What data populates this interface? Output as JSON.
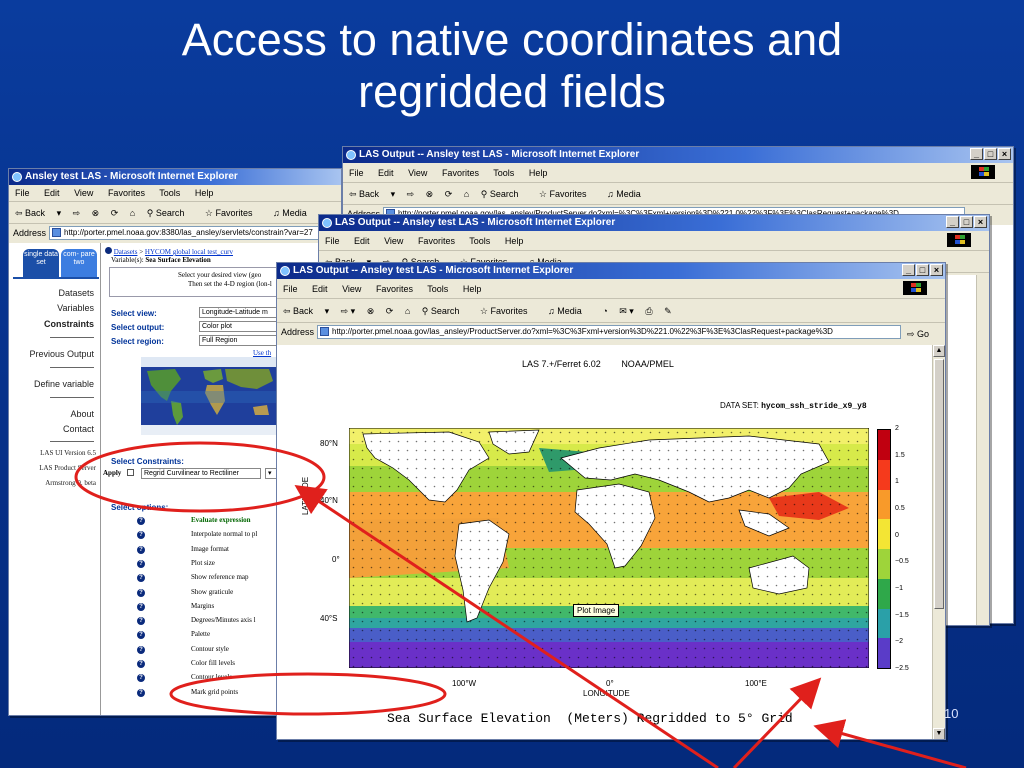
{
  "slide": {
    "title_line1": "Access to native coordinates and",
    "title_line2": "regridded fields",
    "page_number": "10"
  },
  "window_left": {
    "title": "Ansley test LAS - Microsoft Internet Explorer",
    "menu": [
      "File",
      "Edit",
      "View",
      "Favorites",
      "Tools",
      "Help"
    ],
    "toolbar": [
      "Back",
      "Search",
      "Favorites",
      "Media"
    ],
    "address_label": "Address",
    "address_url": "http://porter.pmel.noaa.gov:8380/las_ansley/servlets/constrain?var=27",
    "tabs": [
      {
        "label": "single data set"
      },
      {
        "label": "com- pare two"
      }
    ],
    "nav": [
      "Datasets",
      "Variables",
      "Constraints",
      "Previous Output",
      "Define variable",
      "About",
      "Contact"
    ],
    "nav_footer": [
      "LAS UI Version 6.5",
      "LAS Product Server",
      "Armstrong 0. beta"
    ],
    "breadcrumb_datasets": "Datasets",
    "breadcrumb_sep": " > ",
    "breadcrumb_dataset": "HYCOM global local test_curv",
    "variable_label": "Variable(s):",
    "variable_value": "Sea Surface Elevation",
    "instructions_1": "Select your desired view (geo",
    "instructions_2": "Then set the 4-D region (lon-l",
    "select_view_label": "Select view:",
    "select_view_value": "Longitude-Latitude m",
    "select_output_label": "Select output:",
    "select_output_value": "Color plot",
    "select_region_label": "Select region:",
    "select_region_value": "Full Region",
    "use_link": "Use th",
    "constraints_label": "Select Constraints:",
    "apply_label": "Apply",
    "regrid_value": "Regrid Curvilinear to Rectiliner",
    "options_label": "Select options:",
    "options": [
      "Evaluate expression",
      "Interpolate normal to pl",
      "Image format",
      "Plot size",
      "Show reference map",
      "Show graticule",
      "Margins",
      "Degrees/Minutes axis l",
      "Palette",
      "Contour style",
      "Color fill levels",
      "Contour levels",
      "Mark grid points"
    ]
  },
  "window_back2": {
    "title": "LAS Output -- Ansley test LAS - Microsoft Internet Explorer",
    "menu": [
      "File",
      "Edit",
      "View",
      "Favorites",
      "Tools",
      "Help"
    ],
    "toolbar": [
      "Back",
      "Search",
      "Favorites",
      "Media"
    ],
    "address_label": "Address",
    "address_url": "http://porter.pmel.noaa.gov/las_ansley/ProductServer.do?xml=%3C%3Fxml+version%3D%221.0%22%3F%3E%3ClasRequest+package%3D"
  },
  "window_back1": {
    "title": "LAS Output -- Ansley test LAS - Microsoft Internet Explorer",
    "menu": [
      "File",
      "Edit",
      "View",
      "Favorites",
      "Tools",
      "Help"
    ],
    "toolbar": [
      "Back",
      "Search",
      "Favorites",
      "Media"
    ]
  },
  "window_main": {
    "title": "LAS Output -- Ansley test LAS - Microsoft Internet Explorer",
    "menu": [
      "File",
      "Edit",
      "View",
      "Favorites",
      "Tools",
      "Help"
    ],
    "toolbar": [
      "Back",
      "Search",
      "Favorites",
      "Media"
    ],
    "address_label": "Address",
    "address_url": "http://porter.pmel.noaa.gov/las_ansley/ProductServer.do?xml=%3C%3Fxml+version%3D%221.0%22%3F%3E%3ClasRequest+package%3D",
    "go_label": "Go",
    "plot": {
      "header_left": "LAS 7.+/Ferret 6.02",
      "header_right": "NOAA/PMEL",
      "dataset_label": "DATA SET:",
      "dataset_name": "hycom_ssh_stride_x9_y8",
      "lat_ticks": [
        "80°N",
        "40°N",
        "0°",
        "40°S"
      ],
      "lon_ticks": [
        "100°W",
        "0°",
        "100°E"
      ],
      "ylabel": "LATITUDE",
      "xlabel": "LONGITUDE",
      "tooltip": "Plot Image",
      "caption": "Sea Surface Elevation  (Meters) Regridded to 5° Grid",
      "colorbar_labels": [
        "2",
        "1.5",
        "1",
        "0.5",
        "0",
        "−0.5",
        "−1",
        "−1.5",
        "−2",
        "−2.5"
      ]
    }
  },
  "colors": {
    "slide_background": "#063089",
    "annotation_red": "#e0201c"
  }
}
